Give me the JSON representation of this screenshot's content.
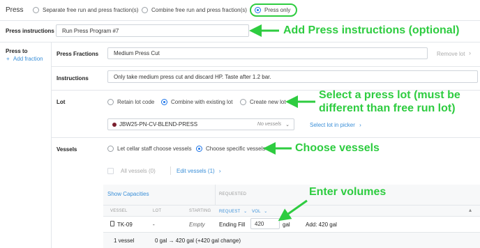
{
  "press_header": {
    "title": "Press",
    "options": [
      "Separate free run and press fraction(s)",
      "Combine free run and press fraction(s)",
      "Press only"
    ],
    "selected_index": 2
  },
  "press_instructions": {
    "label": "Press instructions",
    "value": "Run Press Program #7"
  },
  "press_to": {
    "label": "Press to",
    "add_fraction": "Add fraction"
  },
  "fraction": {
    "label": "Press Fractions",
    "value": "Medium Press Cut",
    "remove": "Remove lot"
  },
  "instructions": {
    "label": "Instructions",
    "value": "Only take medium press cut and discard HP. Taste after 1.2 bar."
  },
  "lot": {
    "label": "Lot",
    "options": [
      "Retain lot code",
      "Combine with existing lot",
      "Create new lot"
    ],
    "selected_index": 1,
    "picker_value": "JBW25-PN-CV-BLEND-PRESS",
    "picker_status": "No vessels",
    "picker_dot_color": "#7b1f2e",
    "select_link": "Select lot in picker"
  },
  "vessels": {
    "label": "Vessels",
    "options": [
      "Let cellar staff choose vessels",
      "Choose specific vessels"
    ],
    "selected_index": 1,
    "all_vessels": "All vessels (0)",
    "edit_link": "Edit vessels (1)"
  },
  "table": {
    "show_capacities": "Show Capacities",
    "requested": "REQUESTED",
    "headers": [
      "VESSEL",
      "LOT",
      "STARTING",
      "REQUEST",
      "VOL"
    ],
    "row": {
      "vessel": "TK-09",
      "lot": "-",
      "starting": "Empty",
      "request": "Ending Fill",
      "vol": "420",
      "unit": "gal",
      "add": "Add: 420 gal"
    },
    "footer": {
      "count": "1 vessel",
      "summary": "0 gal → 420 gal (+420 gal change)"
    }
  },
  "annotations": {
    "a1": "Add Press instructions (optional)",
    "a2_line1": "Select a press lot (must be",
    "a2_line2": "different than free run lot)",
    "a3": "Choose vessels",
    "a4": "Enter volumes",
    "color": "#2ecc40"
  }
}
